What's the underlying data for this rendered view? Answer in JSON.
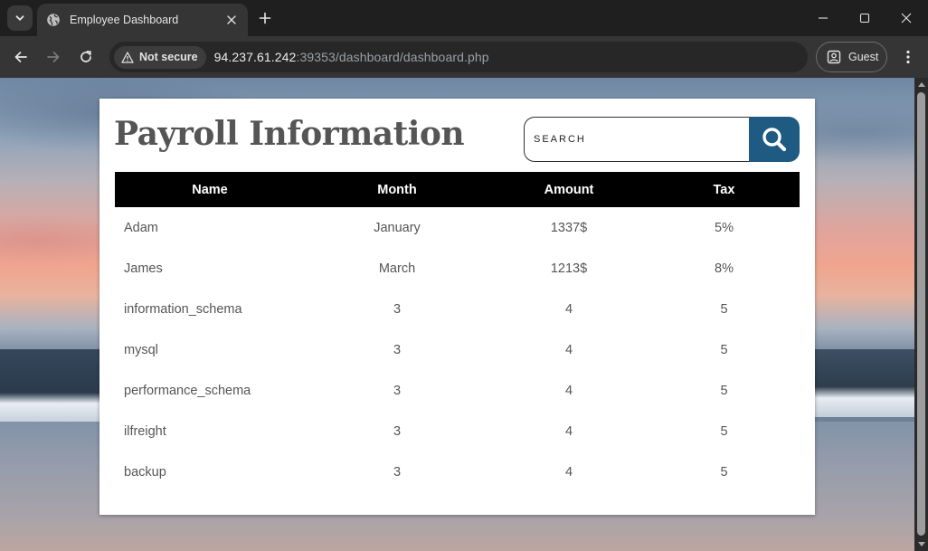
{
  "browser": {
    "tab_title": "Employee Dashboard",
    "security_chip": "Not secure",
    "url_host": "94.237.61.242",
    "url_rest": ":39353/dashboard/dashboard.php",
    "profile_label": "Guest"
  },
  "page": {
    "title": "Payroll Information",
    "search": {
      "placeholder": "SEARCH",
      "value": ""
    },
    "table": {
      "headers": [
        "Name",
        "Month",
        "Amount",
        "Tax"
      ],
      "rows": [
        [
          "Adam",
          "January",
          "1337$",
          "5%"
        ],
        [
          "James",
          "March",
          "1213$",
          "8%"
        ],
        [
          "information_schema",
          "3",
          "4",
          "5"
        ],
        [
          "mysql",
          "3",
          "4",
          "5"
        ],
        [
          "performance_schema",
          "3",
          "4",
          "5"
        ],
        [
          "ilfreight",
          "3",
          "4",
          "5"
        ],
        [
          "backup",
          "3",
          "4",
          "5"
        ]
      ]
    }
  },
  "colors": {
    "search_button": "#1f5a82",
    "table_header_bg": "#000000",
    "title_text": "#555555"
  },
  "icons": {
    "tab_menu": "chevron-down-icon",
    "favicon": "globe-icon",
    "tab_close": "close-icon",
    "new_tab": "plus-icon",
    "back": "arrow-left-icon",
    "forward": "arrow-right-icon",
    "reload": "reload-icon",
    "not_secure": "warning-triangle-icon",
    "profile": "profile-icon",
    "menu": "kebab-menu-icon",
    "search": "search-icon"
  }
}
